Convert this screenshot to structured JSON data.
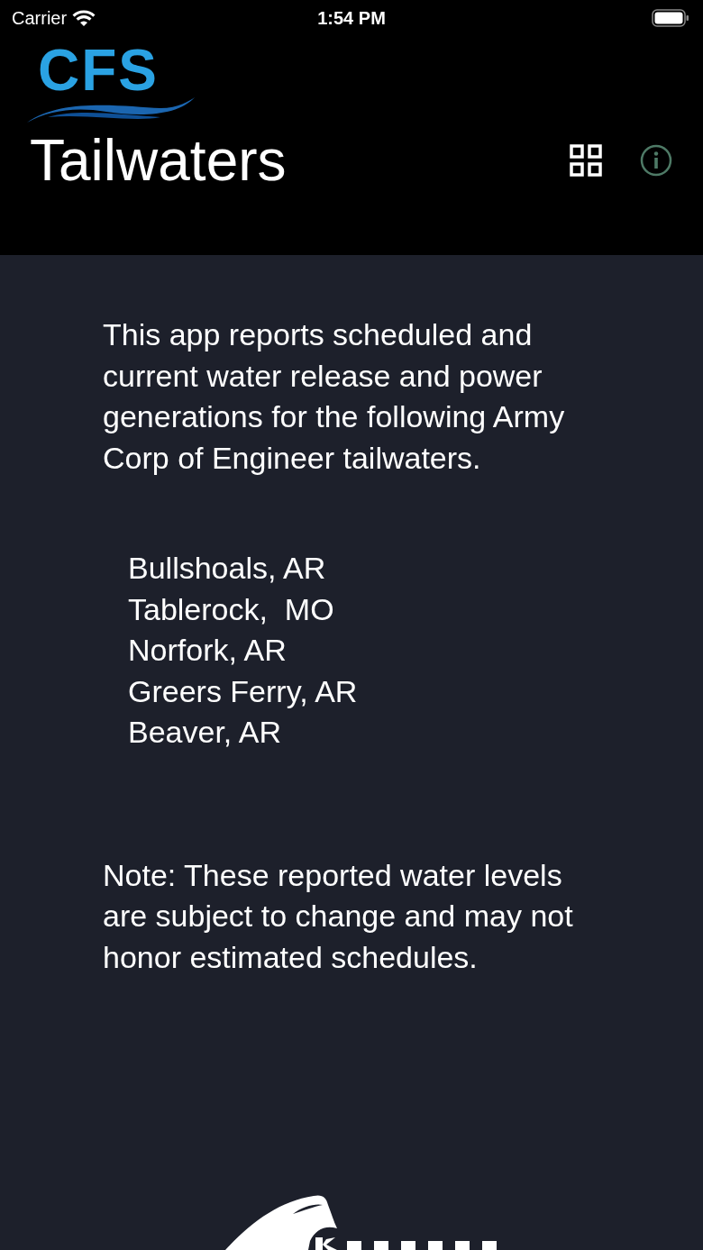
{
  "status_bar": {
    "carrier": "Carrier",
    "time": "1:54 PM"
  },
  "header": {
    "logo": "CFS",
    "title": "Tailwaters"
  },
  "intro": "This app reports scheduled and current water release and power generations for the following Army Corp of Engineer tailwaters.",
  "tailwaters": [
    "Bullshoals, AR",
    "Tablerock,  MO",
    "Norfork, AR",
    "Greers Ferry, AR",
    "Beaver, AR"
  ],
  "note": "Note:  These reported water levels are subject to change and may not honor estimated schedules."
}
